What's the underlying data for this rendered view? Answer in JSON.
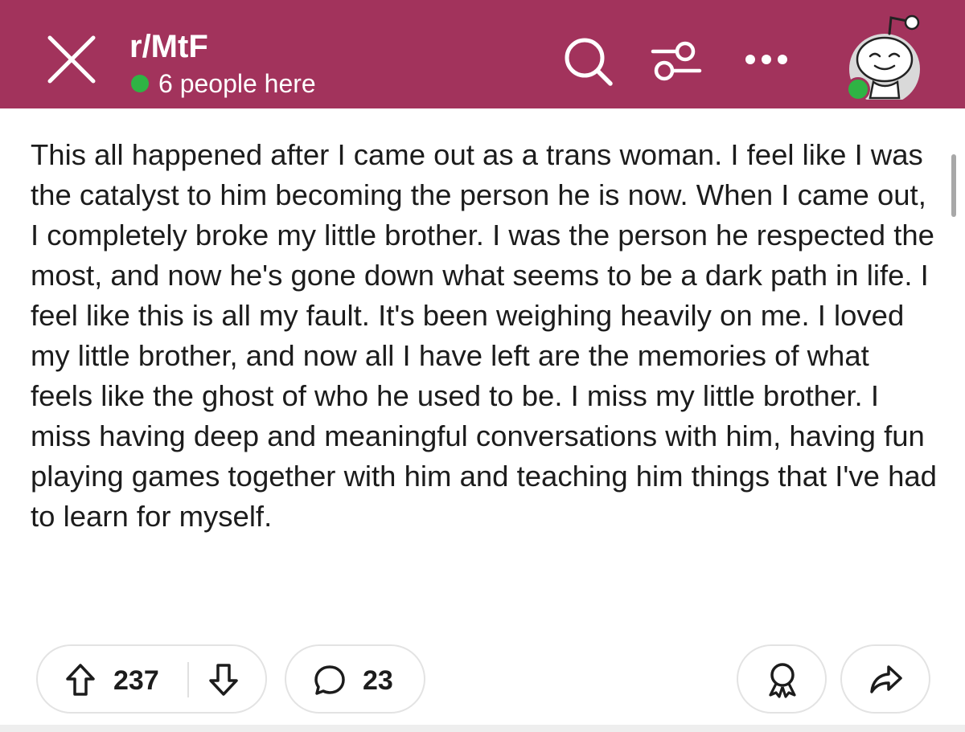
{
  "header": {
    "background_color": "#a2335c",
    "close_icon": "close-icon",
    "subreddit_name": "r/MtF",
    "presence_text": "6 people here",
    "presence_status_color": "#2fb344",
    "actions": [
      {
        "icon": "search-icon"
      },
      {
        "icon": "filter-icon"
      },
      {
        "icon": "more-options-icon"
      }
    ],
    "avatar_icon": "snoo-avatar"
  },
  "post": {
    "body": "This all happened after I came out as a trans woman. I feel like I was the catalyst to him becoming the person he is now. When I came out, I completely broke my little brother. I was the person he respected the most, and now he's gone down what seems to be a dark path in life. I feel like this is all my fault. It's been weighing heavily on me. I loved my little brother, and now all I have left are the memories of what feels like the ghost of who he used to be. I miss my little brother. I miss having deep and meaningful conversations with him, having fun playing games together with him and teaching him things that I've had to learn for myself."
  },
  "actions_bar": {
    "upvote_icon": "upvote-arrow-icon",
    "vote_count": "237",
    "downvote_icon": "downvote-arrow-icon",
    "comment_icon": "comment-bubble-icon",
    "comment_count": "23",
    "award_icon": "award-icon",
    "share_icon": "share-arrow-icon"
  }
}
